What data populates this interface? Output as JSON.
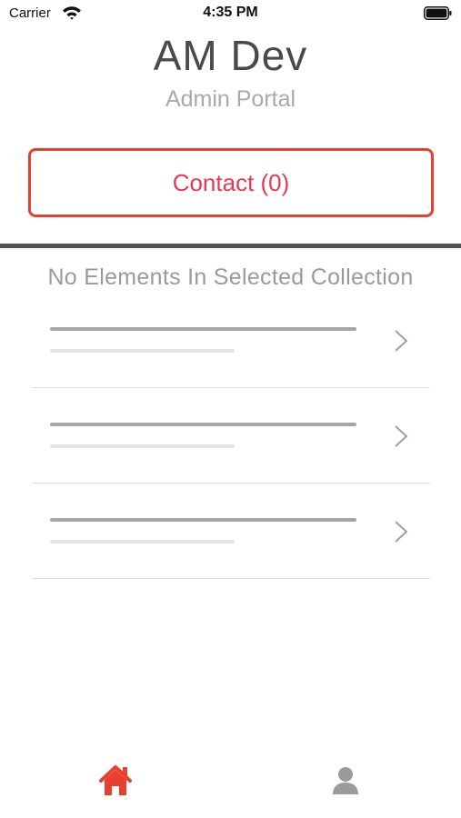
{
  "status_bar": {
    "carrier": "Carrier",
    "time": "4:35 PM",
    "wifi_icon": "wifi-icon",
    "battery_icon": "battery-icon"
  },
  "header": {
    "title": "AM Dev",
    "subtitle": "Admin Portal"
  },
  "contact_button": {
    "label": "Contact (0)",
    "color": "#e8402f",
    "text_color": "#e43a52"
  },
  "collection": {
    "empty_message": "No Elements In Selected Collection",
    "placeholder_rows": 3,
    "row_icon": "chevron-right-icon"
  },
  "tab_bar": {
    "tabs": [
      {
        "icon": "home-icon",
        "active": true,
        "color": "#e8402f"
      },
      {
        "icon": "person-icon",
        "active": false,
        "color": "#9b9b9b"
      }
    ]
  }
}
